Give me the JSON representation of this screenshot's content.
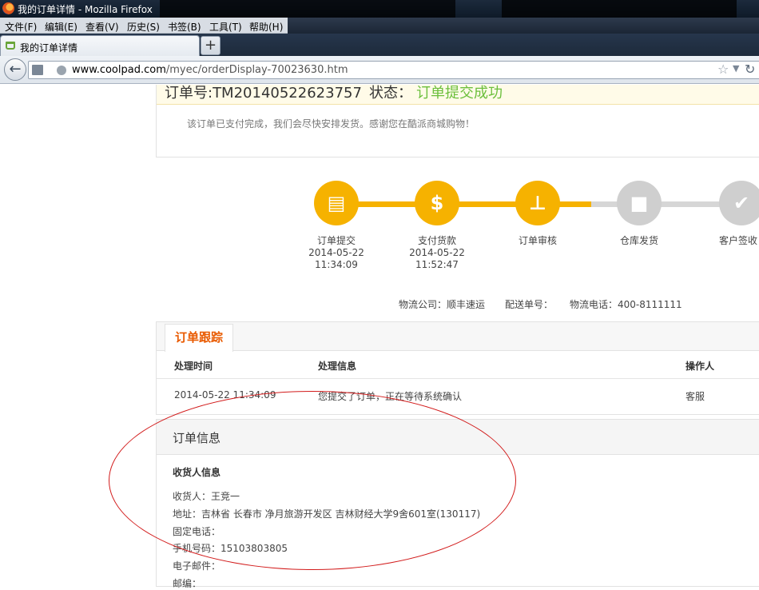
{
  "window": {
    "title": "我的订单详情 - Mozilla Firefox",
    "menu": [
      "文件(F)",
      "编辑(E)",
      "查看(V)",
      "历史(S)",
      "书签(B)",
      "工具(T)",
      "帮助(H)"
    ]
  },
  "tabs": [
    {
      "label": "我的订单详情"
    }
  ],
  "newtab_label": "+",
  "nav": {
    "url_domain": "www.coolpad.com",
    "url_path": "/myec/orderDisplay-70023630.htm"
  },
  "order": {
    "number": "订单号:TM20140522623757",
    "status_label": "状态：",
    "status_value": "订单提交成功",
    "note": "该订单已支付完成，我们会尽快安排发货。感谢您在酷派商城购物！"
  },
  "progress": {
    "steps": [
      {
        "label": "订单提交",
        "date": "2014-05-22",
        "time": "11:34:09",
        "state": "done",
        "icon": "document-icon"
      },
      {
        "label": "支付货款",
        "date": "2014-05-22",
        "time": "11:52:47",
        "state": "done",
        "icon": "payment-icon"
      },
      {
        "label": "订单审核",
        "date": "",
        "time": "",
        "state": "done",
        "icon": "stamp-icon"
      },
      {
        "label": "仓库发货",
        "date": "",
        "time": "",
        "state": "pending",
        "icon": "truck-icon"
      },
      {
        "label": "客户签收",
        "date": "",
        "time": "",
        "state": "pending",
        "icon": "check-icon"
      }
    ],
    "colors": {
      "done": "#f6b200",
      "pending": "#cfcfcf"
    }
  },
  "logistics": {
    "company": "物流公司：顺丰速运",
    "tracking_no": "配送单号：",
    "phone": "物流电话：400-8111111"
  },
  "tracking": {
    "tab": "订单跟踪",
    "headers": [
      "处理时间",
      "处理信息",
      "操作人"
    ],
    "rows": [
      {
        "time": "2014-05-22 11:34:09",
        "info": "您提交了订单，正在等待系统确认",
        "operator": "客服"
      }
    ]
  },
  "order_info": {
    "title": "订单信息",
    "subtitle": "收货人信息",
    "recipient": "收货人：王竞一",
    "address": "地址：吉林省 长春市 净月旅游开发区 吉林财经大学9舍601室(130117)",
    "landline": "固定电话：",
    "mobile": "手机号码：15103803805",
    "email": "电子邮件：",
    "postcode_partial": "邮编："
  }
}
